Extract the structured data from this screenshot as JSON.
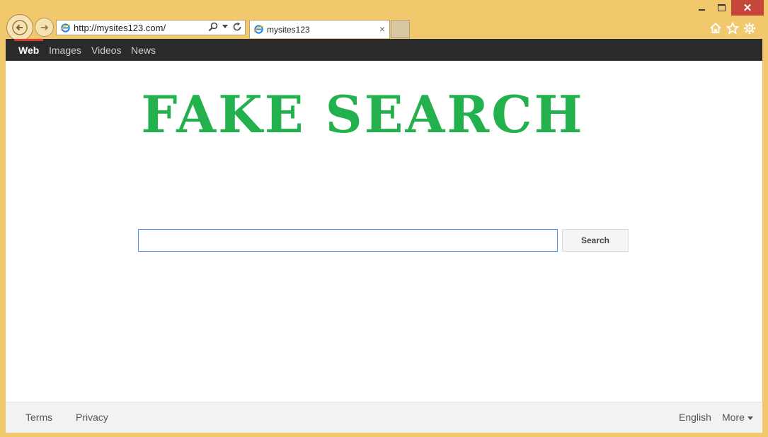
{
  "browser": {
    "address_url": "http://mysites123.com/",
    "tab_title": "mysites123",
    "tab_close": "×",
    "close_glyph": "✕"
  },
  "page": {
    "nav": [
      "Web",
      "Images",
      "Videos",
      "News"
    ],
    "logo": "FAKE SEARCH",
    "search": {
      "value": "",
      "placeholder": "",
      "button": "Search"
    },
    "footer": {
      "left": [
        "Terms",
        "Privacy"
      ],
      "language": "English",
      "more": "More"
    }
  },
  "colors": {
    "logo": "#22b14c",
    "nav_bg": "#2a2a2a",
    "active_indicator": "#dd3b2b",
    "frame": "#f1c86c"
  }
}
